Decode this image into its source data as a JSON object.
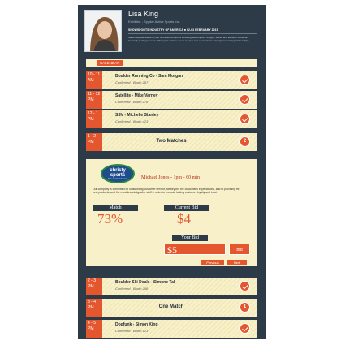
{
  "profile": {
    "name": "Lisa King",
    "subtitle": "Exhibitor - Spyder Active Sports Inc.",
    "show_title": "SNOWSPORTS INDUSTRY OF AMERICA  ■ 02-03 FEBRUARY 2015",
    "show_desc": "Sales Representative for the northwest territories including Washington, Oregon, Idaho, and Western Montana. Currently looking to meet with buyers in these areas to open new accounts and strengthen existing relationships."
  },
  "calendar": {
    "tab_label": "CALENDAR"
  },
  "schedule_top": [
    {
      "time": "10 - 11 AM",
      "title": "Boulder Running Co - Sam Morgan",
      "sub": "Confirmed - Booth 287"
    },
    {
      "time": "11 - 12 PM",
      "title": "Satellite - Mike Varney",
      "sub": "Confirmed - Booth 278"
    },
    {
      "time": "12 - 1 PM",
      "title": "SSV - Michelle Stanley",
      "sub": "Confirmed - Booth 423"
    }
  ],
  "group_row": {
    "time": "1 - 2 PM",
    "title": "Two Matches",
    "count": "2"
  },
  "detail": {
    "logo_line1": "christy",
    "logo_line2": "sports",
    "logo_line3": "Skis and Snowboards",
    "meeting": "Michael Jones - 1pm - 60 min",
    "description": "Our company is committed to outstanding customer service, far beyond the customer's expectations, and to providing the best products, and the most knowledgeable staff in order to promote lasting customer loyalty and trust.",
    "match_label": "Match",
    "match_value": "73%",
    "current_bid_label": "Current Bid",
    "current_bid_value": "$4",
    "your_bid_label": "Your Bid",
    "your_bid_value": "$5",
    "bid_button": "Bid",
    "previous_button": "Previous",
    "next_button": "Next"
  },
  "schedule_bottom": [
    {
      "time": "2 - 3 PM",
      "title": "Boulder Ski Deals - Simone Tal",
      "sub": "Confirmed - Booth 298",
      "kind": "check"
    },
    {
      "time": "3 - 4 PM",
      "title": "One Match",
      "sub": "",
      "kind": "count",
      "count": "1"
    },
    {
      "time": "4 - 5 PM",
      "title": "Dogfunk - Simon King",
      "sub": "Confirmed - Booth 123",
      "kind": "check"
    }
  ],
  "colors": {
    "accent": "#e4572e",
    "panel": "#f7f0c8",
    "frame": "#2d3a47"
  }
}
